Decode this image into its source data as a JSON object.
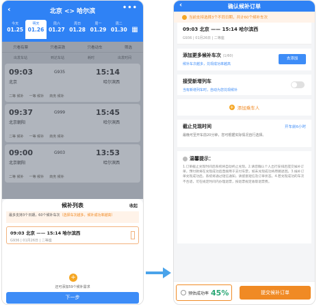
{
  "left": {
    "header": {
      "title": "北京 <> 哈尔滨"
    },
    "dates": [
      {
        "day": "今天",
        "date": "01.25"
      },
      {
        "day": "明天",
        "date": "01.26"
      },
      {
        "day": "周六",
        "date": "01.27"
      },
      {
        "day": "周日",
        "date": "01.28"
      },
      {
        "day": "周一",
        "date": "01.29"
      },
      {
        "day": "周二",
        "date": "01.30"
      }
    ],
    "filters": [
      "只看有票",
      "只看高铁",
      "只看动车",
      "筛选"
    ],
    "subfilters": [
      "出发车站",
      "到达车站",
      "耗时",
      "出发时间"
    ],
    "trains": [
      {
        "dep": "09:03",
        "no": "G935",
        "arr": "15:14",
        "from": "北京",
        "to": "哈尔滨西",
        "seats": [
          "二等 候补",
          "一等 候补",
          "商务 候补"
        ]
      },
      {
        "dep": "09:37",
        "no": "G999",
        "arr": "15:45",
        "from": "北京朝阳",
        "to": "哈尔滨西",
        "seats": [
          "二等 候补",
          "一等 候补",
          "商务 候补"
        ]
      },
      {
        "dep": "09:00",
        "no": "G903",
        "arr": "13:53",
        "from": "北京朝阳",
        "to": "哈尔滨西",
        "seats": [
          "二等 候补",
          "一等 候补",
          "商务 候补"
        ]
      }
    ],
    "sheet": {
      "title": "候补列表",
      "collapse": "收起",
      "note": "最多支持3个日期，60个候补车次",
      "note_warn": "（选择车次越多，候补成功率越高）",
      "item_route": "09:03 北京 —— 15:14 哈尔滨西",
      "item_detail": "G936 | 01月26日 | 二等座",
      "hint": "还可添加59个候补需求",
      "next_btn": "下一步"
    }
  },
  "right": {
    "header_title": "确认候补订单",
    "top_note": "当前支持选择3个不同日期，共计60个候补车次",
    "trip_route": "09:03 北京 —— 15:14 哈尔滨西",
    "trip_detail": "G936 | 01月26日 | 二等座",
    "add_title": "添加更多候补车次",
    "add_count": "(1/60)",
    "add_sub": "候补车次越多，兑现成功率越高",
    "add_btn": "去添加",
    "accept_title": "接受新增列车",
    "accept_sub": "当有新增列车时，自动为您兑现候补",
    "passenger_label": "添加乘车人",
    "deadline_title": "截止兑现时间",
    "deadline_value": "开车前6小时",
    "deadline_desc": "最晚可至开车前20分钟，您可根据实际情况自行选择。",
    "tips_title": "温馨提示：",
    "tips_body": "1.订单截止兑现时间后系统将自动终止兑现。2.请您确认个人出行安排后提交候补订单，预付款将在兑现成功后直接用于支付车票，如未兑现成功将原路退回。3.候补订单兑现成功后，系统将通过短信通知，请留意短信及订单状态。4.若兑现成功的车次不合适，可在规定时间内办理退票，按退票规定收取退票费。",
    "rate_label": "预估成功率",
    "rate_value": "45%",
    "submit_btn": "提交候补订单"
  },
  "colors": {
    "primary": "#2f82f5",
    "orange": "#f08a24",
    "green": "#2aa876"
  }
}
